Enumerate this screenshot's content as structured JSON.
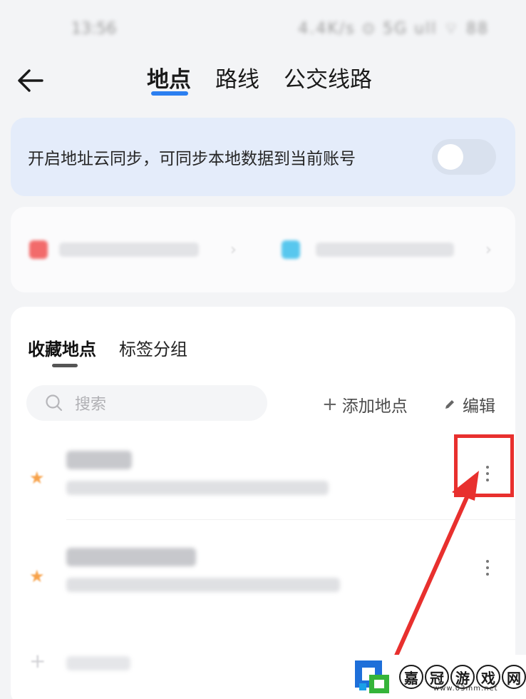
{
  "status_bar": {
    "time": "13:56",
    "icons": "4.4K/s ⊙ 5G ull ⌔ 88"
  },
  "nav": {
    "tabs": [
      {
        "label": "地点",
        "active": true
      },
      {
        "label": "路线",
        "active": false
      },
      {
        "label": "公交线路",
        "active": false
      }
    ]
  },
  "sync": {
    "text": "开启地址云同步，可同步本地数据到当前账号",
    "enabled": false
  },
  "favorites": {
    "subtabs": [
      {
        "label": "收藏地点",
        "active": true
      },
      {
        "label": "标签分组",
        "active": false
      }
    ],
    "search_placeholder": "搜索",
    "add_label": "添加地点",
    "edit_label": "编辑"
  },
  "watermark": {
    "chars": [
      "嘉",
      "冠",
      "游",
      "戏",
      "网"
    ],
    "url": "www.03mm.net"
  },
  "colors": {
    "accent": "#2b7ff0",
    "sync_bg": "#e4ecfa",
    "highlight": "#e8302e",
    "star": "#f7a24a"
  }
}
